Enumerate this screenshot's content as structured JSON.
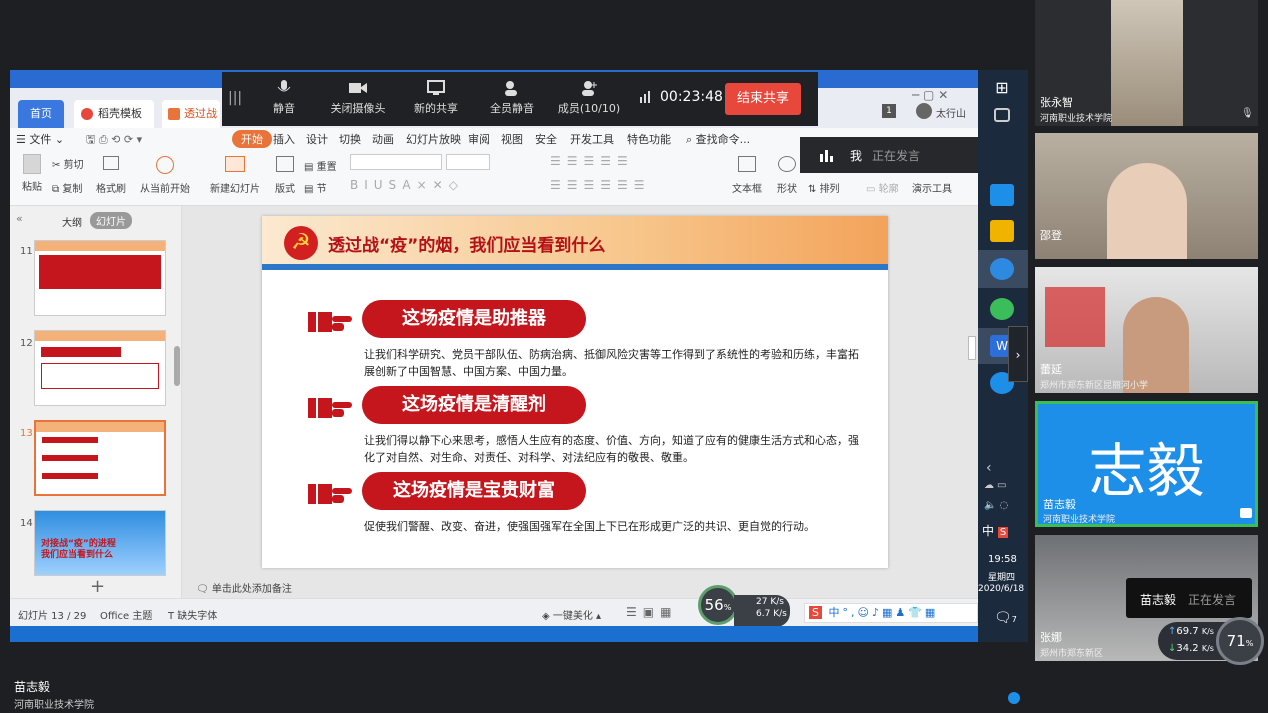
{
  "meeting_bar": {
    "mute": "静音",
    "camera": "关闭摄像头",
    "new_share": "新的共享",
    "mute_all": "全员静音",
    "members": "成员(10/10)",
    "timer": "00:23:48",
    "end_share": "结束共享"
  },
  "wps": {
    "tabs": [
      "首页",
      "稻壳模板",
      "透过战"
    ],
    "user": "太行山",
    "menus": [
      "文件",
      "开始",
      "插入",
      "设计",
      "切换",
      "动画",
      "幻灯片放映",
      "审阅",
      "视图",
      "安全",
      "开发工具",
      "特色功能",
      "查找命令..."
    ],
    "ribbon": {
      "paste": "粘贴",
      "cut": "剪切",
      "copy": "复制",
      "format_painter": "格式刷",
      "from_current": "从当前开始",
      "new_slide": "新建幻灯片",
      "layout": "版式",
      "reset": "重置",
      "section": "节",
      "textbox": "文本框",
      "shape": "形状",
      "arrange": "排列",
      "outline": "轮廓",
      "presentation_tools": "演示工具"
    },
    "panel_tabs": [
      "大纲",
      "幻灯片"
    ],
    "thumb_numbers": [
      "11",
      "12",
      "13",
      "14"
    ],
    "thumb14_text": "对接战“疫”的进程\n我们应当看到什么",
    "add_note": "单击此处添加备注",
    "status": {
      "slide_count": "幻灯片 13 / 29",
      "theme": "Office 主题",
      "missing_font": "缺失字体",
      "beautify": "一键美化"
    },
    "net_percent": "56",
    "net_up": "27",
    "net_up_unit": "K/s",
    "net_down": "6.7",
    "net_down_unit": "K/s"
  },
  "slide": {
    "title": "透过战“疫”的烟，我们应当看到什么",
    "points": [
      {
        "heading": "这场疫情是助推器",
        "text": "让我们科学研究、党员干部队伍、防病治病、抵御风险灾害等工作得到了系统性的考验和历练，丰富拓展创新了中国智慧、中国方案、中国力量。"
      },
      {
        "heading": "这场疫情是清醒剂",
        "text": "让我们得以静下心来思考，感悟人生应有的态度、价值、方向，知道了应有的健康生活方式和心态，强化了对自然、对生命、对责任、对科学、对法纪应有的敬畏、敬重。"
      },
      {
        "heading": "这场疫情是宝贵财富",
        "text": "促使我们警醒、改变、奋进，使强国强军在全国上下已在形成更广泛的共识、更自觉的行动。"
      }
    ]
  },
  "speaking_top": {
    "name": "我",
    "status": "正在发言"
  },
  "taskbar": {
    "time": "19:58",
    "weekday": "星期四",
    "date": "2020/6/18",
    "ime": "中",
    "badge": "7"
  },
  "participants": [
    {
      "name": "张永智",
      "org": "河南职业技术学院"
    },
    {
      "name": "邵登",
      "org": ""
    },
    {
      "name": "蕾延",
      "org": "郑州市郑东新区昆丽河小学"
    },
    {
      "name": "苗志毅",
      "org": "河南职业技术学院",
      "avatar_text": "志毅"
    },
    {
      "name": "张娜",
      "org": "郑州市郑东新区"
    }
  ],
  "speaking_bottom": {
    "name": "苗志毅",
    "status": "正在发言"
  },
  "net_right": {
    "up": "69.7",
    "down": "34.2",
    "unit": "K/s",
    "percent": "71"
  },
  "self": {
    "name": "苗志毅",
    "org": "河南职业技术学院"
  },
  "colors": {
    "accent_red": "#c4161c",
    "end_red": "#e8473b",
    "active_blue": "#1e8fe8",
    "active_green": "#3cbd5b"
  }
}
